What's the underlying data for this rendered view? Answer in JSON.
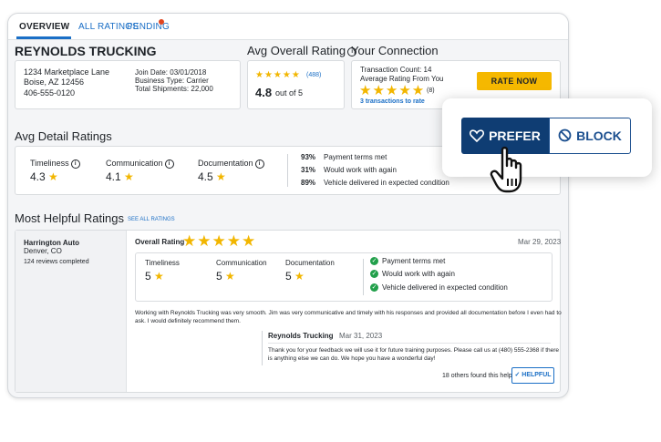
{
  "tabs": [
    {
      "label": "OVERVIEW"
    },
    {
      "label": "ALL RATINGS"
    },
    {
      "label": "PENDING"
    }
  ],
  "company": {
    "name": "REYNOLDS TRUCKING",
    "address1": "1234 Marketplace Lane",
    "address2": "Boise, AZ 12456",
    "phone": "406-555-0120",
    "join_date": "Join Date: 03/01/2018",
    "business_type": "Business Type: Carrier",
    "total_shipments": "Total Shipments: 22,000"
  },
  "avg_overall": {
    "heading": "Avg Overall Rating",
    "count": "(488)",
    "score": "4.8",
    "out_of": "out of 5",
    "stars": "★★★★★"
  },
  "connection": {
    "heading": "Your Connection",
    "transaction_count": "Transaction Count: 14",
    "avg_label": "Average Rating From You",
    "stars": "★★★★★",
    "count": "(8)",
    "to_rate": "3 transactions to rate",
    "rate_button": "RATE NOW"
  },
  "detail": {
    "heading": "Avg Detail Ratings",
    "items": [
      {
        "label": "Timeliness",
        "value": "4.3"
      },
      {
        "label": "Communication",
        "value": "4.1"
      },
      {
        "label": "Documentation",
        "value": "4.5"
      }
    ],
    "percents": [
      {
        "pct": "93%",
        "text": "Payment terms met"
      },
      {
        "pct": "31%",
        "text": "Would work with again"
      },
      {
        "pct": "89%",
        "text": "Vehicle delivered in expected condition"
      }
    ]
  },
  "helpful": {
    "heading": "Most Helpful Ratings",
    "see_all": "SEE ALL RATINGS",
    "review": {
      "reviewer": "Harrington Auto",
      "location": "Denver, CO",
      "reviews_completed": "124 reviews completed",
      "overall_label": "Overall Rating",
      "stars": "★★★★★",
      "date": "Mar 29, 2023",
      "items": [
        {
          "label": "Timeliness",
          "value": "5"
        },
        {
          "label": "Communication",
          "value": "5"
        },
        {
          "label": "Documentation",
          "value": "5"
        }
      ],
      "checks": [
        "Payment terms met",
        "Would work with again",
        "Vehicle delivered in expected condition"
      ],
      "comment_line1": "Working with Reynolds Trucking was very smooth. Jim was very communicative and timely with his responses and provided all documentation before I even had to",
      "comment_line2": "ask. I would definitely recommend them.",
      "response": {
        "author": "Reynolds Trucking",
        "date": "Mar 31, 2023",
        "line1": "Thank you for your feedback we will use it for future training purposes. Please call us at (480) 555-2368 if there",
        "line2": "is anything else we can do. We hope you have a wonderful day!"
      },
      "found_helpful": "18 others found this helpful",
      "helpful_button": "HELPFUL"
    }
  },
  "popup": {
    "prefer_label": "PREFER",
    "block_label": "BLOCK"
  },
  "colors": {
    "accent_blue": "#1b6fc6",
    "star_gold": "#f2b600",
    "rate_yellow": "#f5b800",
    "navy": "#0f3d73",
    "check_green": "#22a04b",
    "pending_dot": "#e0451f"
  }
}
